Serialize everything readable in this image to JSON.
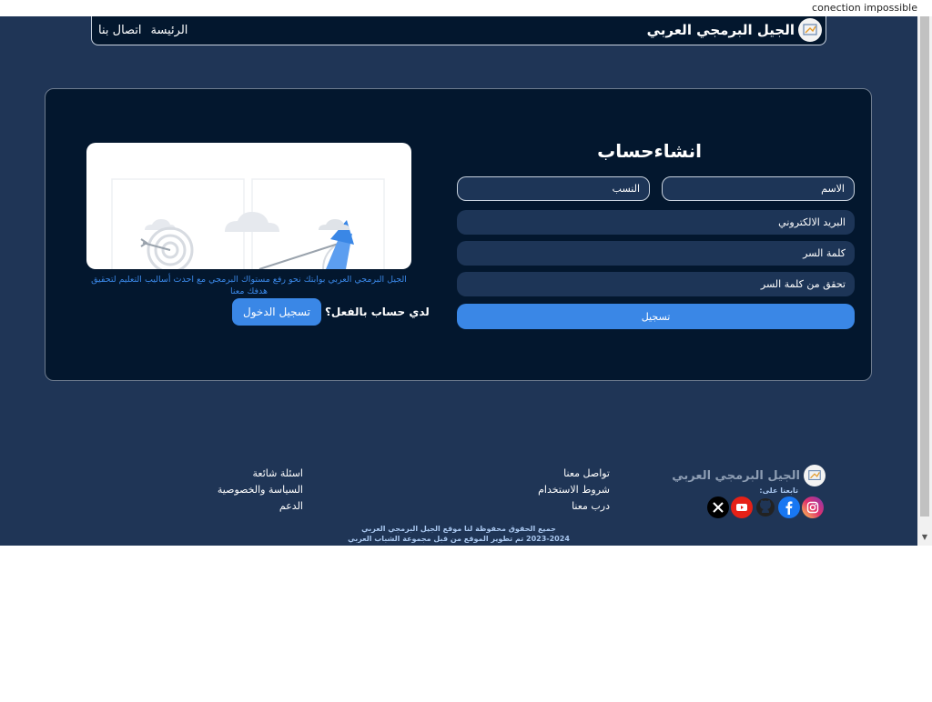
{
  "browser": {
    "error_text": "conection impossible"
  },
  "navbar": {
    "brand": "الجيل البرمجي العربي",
    "links": [
      "الرئيسة",
      "اتصال بنا"
    ]
  },
  "form": {
    "title": "انشاءحساب",
    "first_name_placeholder": "الاسم",
    "last_name_placeholder": "النسب",
    "email_placeholder": "البريد الالكتروني",
    "password_placeholder": "كلمة السر",
    "confirm_password_placeholder": "تحقق من كلمة السر",
    "submit_label": "تسجيل"
  },
  "side": {
    "tagline": "الجيل البرمجي العربي بوابتك نحو رفع مستواك البرمجي مع احدث أساليب التعليم لتحقيق هدفك معنا",
    "login_question": "لدي حساب بالفعل؟",
    "login_button": "تسجيل الدخول"
  },
  "footer": {
    "brand": "الجيل البرمجي العربي",
    "follow_us": "تابعنا على:",
    "social": [
      {
        "name": "instagram-icon",
        "color": "#d6249f"
      },
      {
        "name": "facebook-icon",
        "color": "#1877f2"
      },
      {
        "name": "github-icon",
        "color": "#222222"
      },
      {
        "name": "youtube-icon",
        "color": "#e62117"
      },
      {
        "name": "x-icon",
        "color": "#000000"
      }
    ],
    "col1": [
      "تواصل معنا",
      "شروط الاستخدام",
      "درب معنا"
    ],
    "col2": [
      "اسئلة شائعة",
      "السياسة والخصوصية",
      "الدعم"
    ],
    "copyright_line1": "جميع الحقوق محفوظة لنا موقع الجيل البرمجي العربي",
    "copyright_line2": "2023-2024 تم تطوير الموقع من قبل مجموعة الشباب العربي"
  }
}
